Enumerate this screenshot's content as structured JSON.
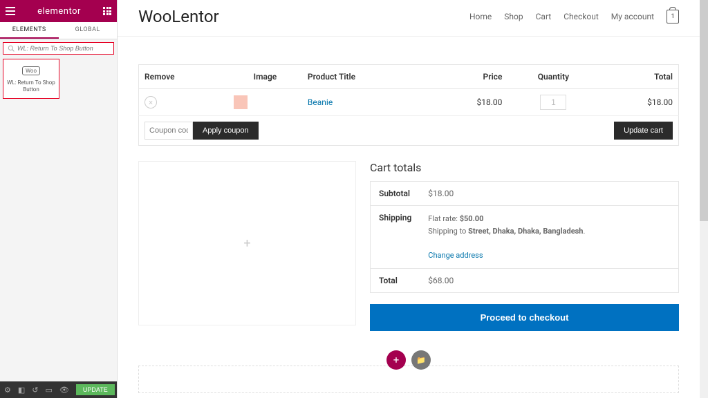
{
  "sidebar": {
    "title": "elementor",
    "tabs": {
      "elements": "ELEMENTS",
      "global": "GLOBAL"
    },
    "search_placeholder": "WL: Return To Shop Button",
    "widget": {
      "icon_text": "Woo",
      "label": "WL: Return To Shop Button"
    },
    "footer": {
      "update": "UPDATE"
    }
  },
  "header": {
    "site_title": "WooLentor",
    "nav": [
      "Home",
      "Shop",
      "Cart",
      "Checkout",
      "My account"
    ],
    "bag_count": "1"
  },
  "cart": {
    "headers": {
      "remove": "Remove",
      "image": "Image",
      "title": "Product Title",
      "price": "Price",
      "qty": "Quantity",
      "total": "Total"
    },
    "items": [
      {
        "title": "Beanie",
        "price": "$18.00",
        "qty": "1",
        "total": "$18.00"
      }
    ],
    "coupon_placeholder": "Coupon code",
    "apply_coupon": "Apply coupon",
    "update_cart": "Update cart"
  },
  "totals": {
    "title": "Cart totals",
    "subtotal_label": "Subtotal",
    "subtotal_value": "$18.00",
    "shipping_label": "Shipping",
    "shipping_flat_prefix": "Flat rate: ",
    "shipping_flat_value": "$50.00",
    "shipping_to_prefix": "Shipping to ",
    "shipping_address": "Street, Dhaka, Dhaka, Bangladesh",
    "change_address": "Change address",
    "total_label": "Total",
    "total_value": "$68.00",
    "checkout": "Proceed to checkout"
  }
}
